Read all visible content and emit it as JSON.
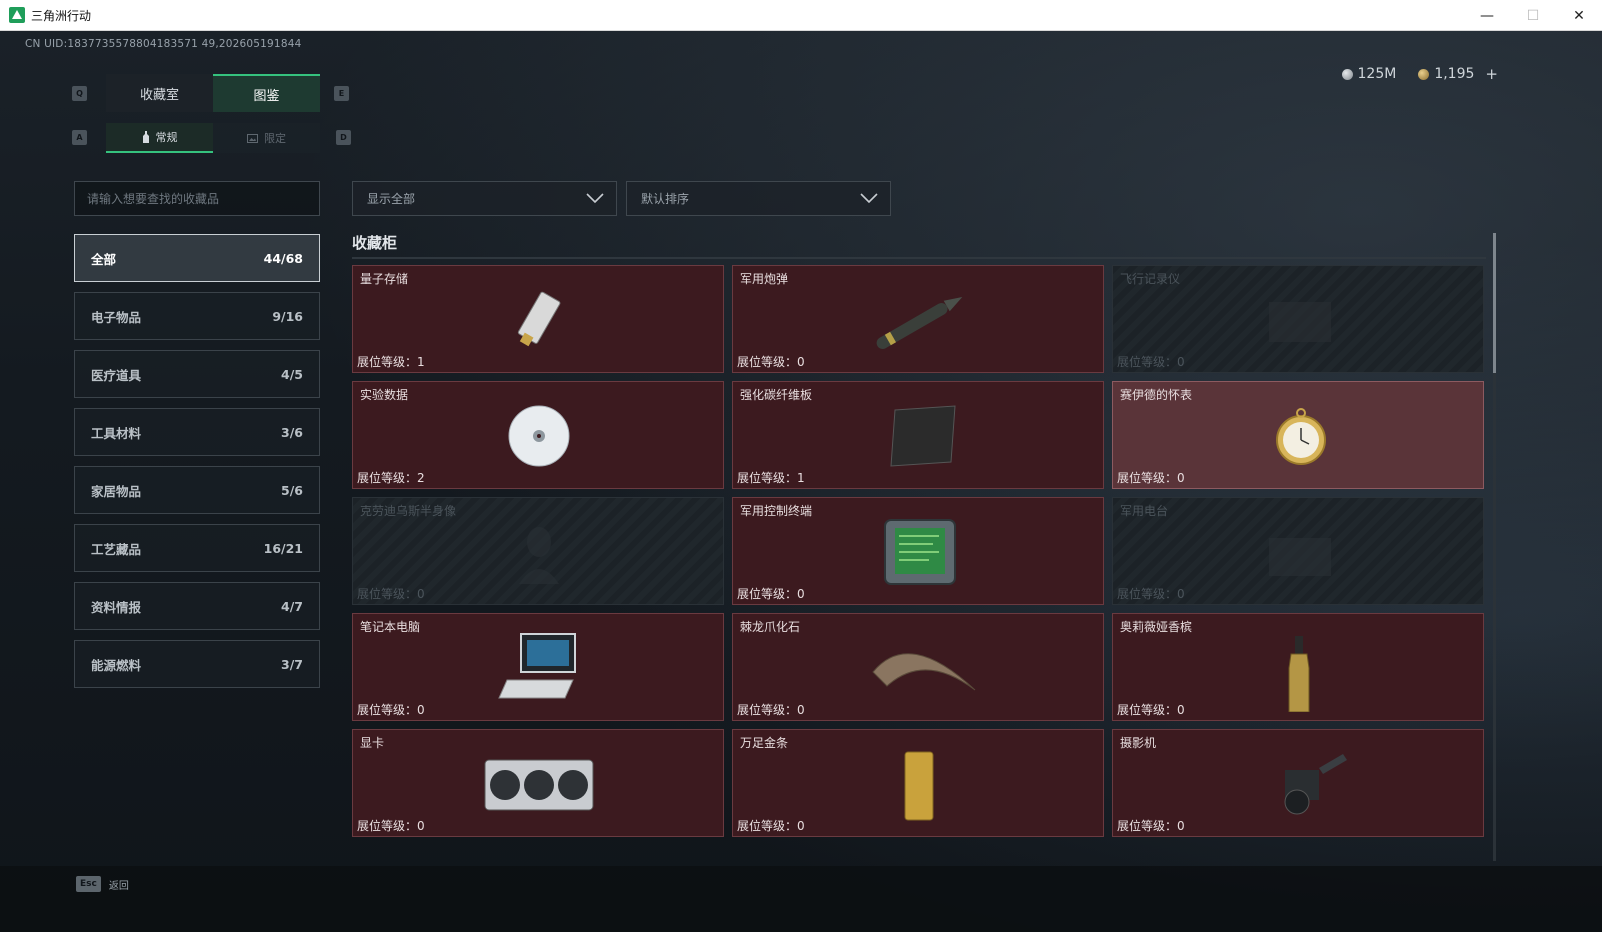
{
  "window": {
    "title": "三角洲行动"
  },
  "uid": "CN UID:1837735578804183571 49,202605191844",
  "currency": {
    "silver": "125M",
    "gold": "1,195",
    "plus": "+"
  },
  "keys": {
    "q": "Q",
    "e": "E",
    "a": "A",
    "d": "D"
  },
  "tabs": [
    {
      "label": "收藏室"
    },
    {
      "label": "图鉴"
    }
  ],
  "subtabs": [
    {
      "label": "常规"
    },
    {
      "label": "限定"
    }
  ],
  "search": {
    "placeholder": "请输入想要查找的收藏品"
  },
  "filters": {
    "show": "显示全部",
    "sort": "默认排序"
  },
  "categories": [
    {
      "label": "全部",
      "count": "44/68"
    },
    {
      "label": "电子物品",
      "count": "9/16"
    },
    {
      "label": "医疗道具",
      "count": "4/5"
    },
    {
      "label": "工具材料",
      "count": "3/6"
    },
    {
      "label": "家居物品",
      "count": "5/6"
    },
    {
      "label": "工艺藏品",
      "count": "16/21"
    },
    {
      "label": "资料情报",
      "count": "4/7"
    },
    {
      "label": "能源燃料",
      "count": "3/7"
    }
  ],
  "section": {
    "title": "收藏柜"
  },
  "level_prefix": "展位等级：",
  "items": [
    {
      "name": "量子存储",
      "level": "1",
      "state": "owned",
      "icon": "usb-drive-icon"
    },
    {
      "name": "军用炮弹",
      "level": "0",
      "state": "owned",
      "icon": "artillery-shell-icon"
    },
    {
      "name": "飞行记录仪",
      "level": "0",
      "state": "locked",
      "icon": "flight-recorder-icon"
    },
    {
      "name": "实验数据",
      "level": "2",
      "state": "owned",
      "icon": "disc-icon"
    },
    {
      "name": "强化碳纤维板",
      "level": "1",
      "state": "owned",
      "icon": "carbon-plate-icon"
    },
    {
      "name": "赛伊德的怀表",
      "level": "0",
      "state": "highlight",
      "icon": "pocket-watch-icon"
    },
    {
      "name": "克劳迪乌斯半身像",
      "level": "0",
      "state": "locked",
      "icon": "bust-icon"
    },
    {
      "name": "军用控制终端",
      "level": "0",
      "state": "owned",
      "icon": "control-terminal-icon"
    },
    {
      "name": "军用电台",
      "level": "0",
      "state": "locked",
      "icon": "radio-icon"
    },
    {
      "name": "笔记本电脑",
      "level": "0",
      "state": "owned",
      "icon": "laptop-icon"
    },
    {
      "name": "棘龙爪化石",
      "level": "0",
      "state": "owned",
      "icon": "claw-fossil-icon"
    },
    {
      "name": "奥莉薇娅香槟",
      "level": "0",
      "state": "owned",
      "icon": "champagne-icon"
    },
    {
      "name": "显卡",
      "level": "0",
      "state": "owned",
      "icon": "graphics-card-icon"
    },
    {
      "name": "万足金条",
      "level": "0",
      "state": "owned",
      "icon": "gold-bar-icon"
    },
    {
      "name": "摄影机",
      "level": "0",
      "state": "owned",
      "icon": "camera-icon"
    }
  ],
  "footer": {
    "esc_key": "Esc",
    "back": "返回"
  }
}
